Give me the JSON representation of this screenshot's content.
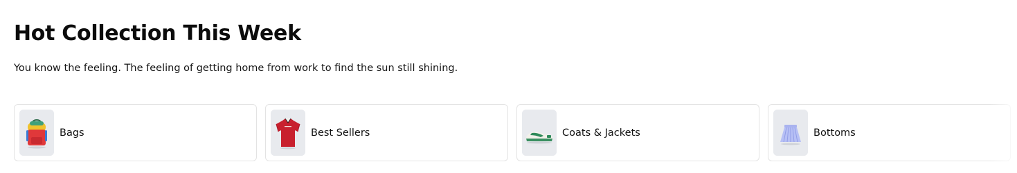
{
  "section": {
    "title": "Hot Collection This Week",
    "subtitle": "You know the feeling. The feeling of getting home from work to find the sun still shining."
  },
  "categories": [
    {
      "label": "Bags",
      "icon": "backpack-image"
    },
    {
      "label": "Best Sellers",
      "icon": "red-shirt-image"
    },
    {
      "label": "Coats & Jackets",
      "icon": "sneaker-image"
    },
    {
      "label": "Bottoms",
      "icon": "pleated-skirt-image"
    }
  ],
  "colors": {
    "card_border": "#e3e3e3",
    "thumb_background": "#e8eaee",
    "text": "#0c0c0c"
  }
}
